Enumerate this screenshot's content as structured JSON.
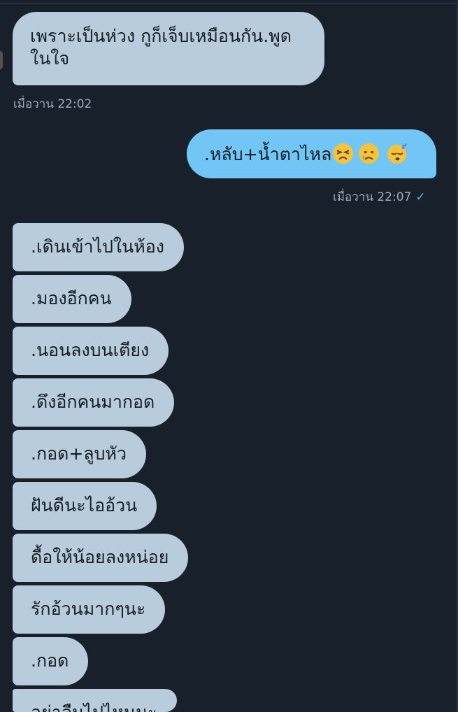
{
  "messages": [
    {
      "text": "เพราะเป็นห่วง กูก็เจ็บเหมือนกัน.พูดในใจ",
      "direction": "incoming"
    }
  ],
  "timestamps": {
    "first": "เมื่อวาน 22:02",
    "second": "เมื่อวาน 22:07"
  },
  "sent_message": {
    "text": ".หลับ+น้ำตาไหล",
    "emojis": [
      "persevering-face",
      "crying-face",
      "sleeping-face"
    ],
    "status": "✓"
  },
  "incoming_sequence": [
    ".เดินเข้าไปในห้อง",
    ".มองอีกคน",
    ".นอนลงบนเตียง",
    ".ดึงอีกคนมากอด",
    ".กอด+ลูบหัว",
    "ฝันดีนะไออ้วน",
    "ดื้อให้น้อยลงหน่อย",
    "รักอ้วนมากๆนะ",
    ".กอด",
    "อย่าลืมไปไหนนะ"
  ],
  "colors": {
    "background": "#18202b",
    "incoming_bubble": "#b8ccdb",
    "outgoing_bubble": "#72c6f6",
    "timestamp": "#a0abb8",
    "check": "#5aaee8"
  }
}
